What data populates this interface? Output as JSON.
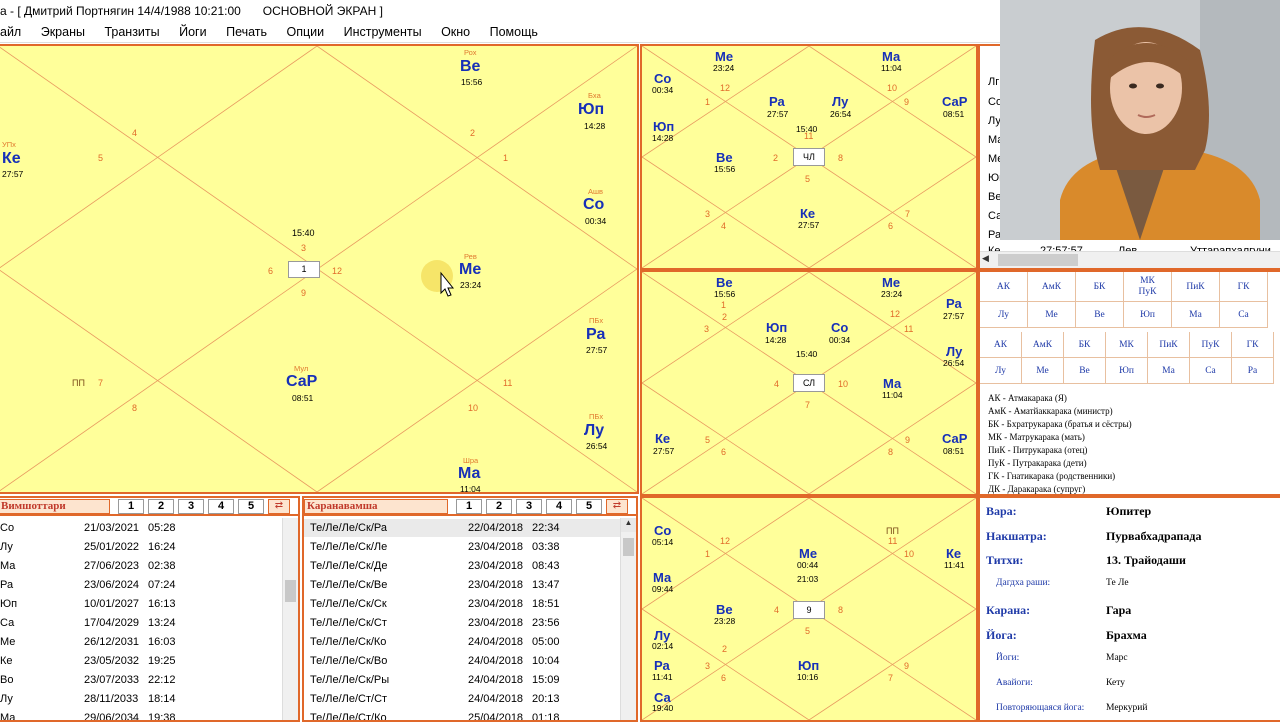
{
  "title": {
    "text": "а - [ Дмитрий Портнягин  14/4/1988  10:21:00",
    "screen": "ОСНОВНОЙ ЭКРАН ]"
  },
  "menu": [
    "айл",
    "Экраны",
    "Транзиты",
    "Йоги",
    "Печать",
    "Опции",
    "Инструменты",
    "Окно",
    "Помощь"
  ],
  "main_chart": {
    "center": {
      "time": "15:40",
      "house": "1"
    },
    "planets": [
      {
        "name": "Ве",
        "deg": "15:56",
        "nak": "Рох"
      },
      {
        "name": "Юп",
        "deg": "14:28",
        "nak": "Бхa"
      },
      {
        "name": "Ке",
        "deg": "27:57",
        "nak": "УПх"
      },
      {
        "name": "Со",
        "deg": "00:34",
        "nak": "Ашв"
      },
      {
        "name": "Ме",
        "deg": "23:24",
        "nak": "Рев"
      },
      {
        "name": "Ра",
        "deg": "27:57",
        "nak": "ПБх"
      },
      {
        "name": "СаР",
        "deg": "08:51",
        "nak": "Мул"
      },
      {
        "name": "Лу",
        "deg": "26:54",
        "nak": "ПБх"
      },
      {
        "name": "Ма",
        "deg": "11:04",
        "nak": "Шра"
      }
    ],
    "houses": [
      "4",
      "5",
      "2",
      "1",
      "3",
      "6",
      "12",
      "9",
      "7",
      "8",
      "11",
      "10"
    ],
    "extra": "ПП"
  },
  "chart_tr": {
    "center": {
      "time": "15:40",
      "label": "ЧЛ"
    },
    "planets": [
      {
        "name": "Ме",
        "deg": "23:24"
      },
      {
        "name": "Ма",
        "deg": "11:04"
      },
      {
        "name": "Со",
        "deg": "00:34"
      },
      {
        "name": "Юп",
        "deg": "14:28"
      },
      {
        "name": "Ра",
        "deg": "27:57"
      },
      {
        "name": "Лу",
        "deg": "26:54"
      },
      {
        "name": "СаР",
        "deg": "08:51"
      },
      {
        "name": "Ве",
        "deg": "15:56"
      },
      {
        "name": "Ке",
        "deg": "27:57"
      }
    ],
    "houses": [
      "1",
      "12",
      "10",
      "9",
      "11",
      "2",
      "8",
      "5",
      "3",
      "7",
      "4",
      "6"
    ]
  },
  "chart_mr": {
    "center": {
      "time": "15:40",
      "label": "СЛ"
    },
    "planets": [
      {
        "name": "Ве",
        "deg": "15:56"
      },
      {
        "name": "Ме",
        "deg": "23:24"
      },
      {
        "name": "Ра",
        "deg": "27:57"
      },
      {
        "name": "Юп",
        "deg": "14:28"
      },
      {
        "name": "Со",
        "deg": "00:34"
      },
      {
        "name": "Лу",
        "deg": "26:54"
      },
      {
        "name": "Ма",
        "deg": "11:04"
      },
      {
        "name": "Ке",
        "deg": "27:57"
      },
      {
        "name": "СаР",
        "deg": "08:51"
      }
    ],
    "houses": [
      "1",
      "2",
      "12",
      "3",
      "11",
      "4",
      "10",
      "5",
      "9",
      "6",
      "8",
      "7"
    ]
  },
  "chart_br": {
    "center": {
      "time": "21:03",
      "label": "9"
    },
    "planets": [
      {
        "name": "Со",
        "deg": "05:14"
      },
      {
        "name": "Ма",
        "deg": "09:44"
      },
      {
        "name": "Ме",
        "deg": "00:44"
      },
      {
        "name": "Ке",
        "deg": "11:41"
      },
      {
        "name": "Ве",
        "deg": "23:28"
      },
      {
        "name": "Лу",
        "deg": "02:14"
      },
      {
        "name": "Ра",
        "deg": "11:41"
      },
      {
        "name": "Юп",
        "deg": "10:16"
      },
      {
        "name": "Са",
        "deg": "19:40"
      }
    ],
    "houses": [
      "1",
      "12",
      "11",
      "2",
      "3",
      "10",
      "4",
      "9",
      "5",
      "8",
      "6",
      "7"
    ],
    "extra": "ПП"
  },
  "dasha_left": {
    "title": "Вимшоттари",
    "tabs": [
      "1",
      "2",
      "3",
      "4",
      "5"
    ],
    "rows": [
      {
        "name": "Со",
        "date": "21/03/2021",
        "time": "05:28"
      },
      {
        "name": "Лу",
        "date": "25/01/2022",
        "time": "16:24"
      },
      {
        "name": "Ма",
        "date": "27/06/2023",
        "time": "02:38"
      },
      {
        "name": "Ра",
        "date": "23/06/2024",
        "time": "07:24"
      },
      {
        "name": "Юп",
        "date": "10/01/2027",
        "time": "16:13"
      },
      {
        "name": "Са",
        "date": "17/04/2029",
        "time": "13:24"
      },
      {
        "name": "Ме",
        "date": "26/12/2031",
        "time": "16:03"
      },
      {
        "name": "Ке",
        "date": "23/05/2032",
        "time": "19:25"
      },
      {
        "name": "Во",
        "date": "23/07/2033",
        "time": "22:12"
      },
      {
        "name": "Лу",
        "date": "28/11/2033",
        "time": "18:14"
      },
      {
        "name": "Ма",
        "date": "29/06/2034",
        "time": "19:38"
      }
    ]
  },
  "dasha_right": {
    "title": "Каранавамша",
    "tabs": [
      "1",
      "2",
      "3",
      "4",
      "5"
    ],
    "rows": [
      {
        "name": "Те/Ле/Ле/Ск/Ра",
        "date": "22/04/2018",
        "time": "22:34"
      },
      {
        "name": "Те/Ле/Ле/Ск/Ле",
        "date": "23/04/2018",
        "time": "03:38"
      },
      {
        "name": "Те/Ле/Ле/Ск/Де",
        "date": "23/04/2018",
        "time": "08:43"
      },
      {
        "name": "Те/Ле/Ле/Ск/Ве",
        "date": "23/04/2018",
        "time": "13:47"
      },
      {
        "name": "Те/Ле/Ле/Ск/Ск",
        "date": "23/04/2018",
        "time": "18:51"
      },
      {
        "name": "Те/Ле/Ле/Ск/Ст",
        "date": "23/04/2018",
        "time": "23:56"
      },
      {
        "name": "Те/Ле/Ле/Ск/Ко",
        "date": "24/04/2018",
        "time": "05:00"
      },
      {
        "name": "Те/Ле/Ле/Ск/Во",
        "date": "24/04/2018",
        "time": "10:04"
      },
      {
        "name": "Те/Ле/Ле/Ск/Ры",
        "date": "24/04/2018",
        "time": "15:09"
      },
      {
        "name": "Те/Ле/Ле/Ст/Ст",
        "date": "24/04/2018",
        "time": "20:13"
      },
      {
        "name": "Те/Ле/Ле/Ст/Ко",
        "date": "25/04/2018",
        "time": "01:18"
      }
    ]
  },
  "planet_table": {
    "rows": [
      {
        "name": "Лг",
        "deg": "",
        "sign": "",
        "nak": ""
      },
      {
        "name": "Со",
        "deg": "",
        "sign": "",
        "nak": ""
      },
      {
        "name": "Лу",
        "deg": "",
        "sign": "",
        "nak": ""
      },
      {
        "name": "Ма",
        "deg": "",
        "sign": "",
        "nak": ""
      },
      {
        "name": "Ме",
        "deg": "",
        "sign": "",
        "nak": ""
      },
      {
        "name": "Юп",
        "deg": "",
        "sign": "",
        "nak": ""
      },
      {
        "name": "Ве",
        "deg": "",
        "sign": "",
        "nak": ""
      },
      {
        "name": "Са",
        "deg": "",
        "sign": "",
        "nak": ""
      },
      {
        "name": "Ра",
        "deg": "",
        "sign": "",
        "nak": ""
      },
      {
        "name": "Ке",
        "deg": "27:57:57",
        "sign": "Лев",
        "nak": "Уттарапхалгуни"
      }
    ]
  },
  "karakas1": {
    "headers": [
      "АК",
      "АмК",
      "БК",
      "МК ПуК",
      "ПиК",
      "ГК"
    ],
    "values": [
      "Лу",
      "Ме",
      "Ве",
      "Юп",
      "Ма",
      "Са"
    ]
  },
  "karakas2": {
    "headers": [
      "АК",
      "АмК",
      "БК",
      "МК",
      "ПиК",
      "ПуК",
      "ГК"
    ],
    "values": [
      "Лу",
      "Ме",
      "Ве",
      "Юп",
      "Ма",
      "Са",
      "Ра"
    ]
  },
  "legend": [
    "АК - Атмакарака (Я)",
    "АмК - Аматйаккарака (министр)",
    "БК - Бхратрукарака (братья и сёстры)",
    "МК - Матрукарака (мать)",
    "ПиК - Питрукарака (отец)",
    "ПуК - Путракарака (дети)",
    "ГК - Гнатикарака (родственники)",
    "ДК - Даракарака (супруг)"
  ],
  "panchanga": {
    "vara": {
      "label": "Вара:",
      "value": "Юпитер"
    },
    "nakshatra": {
      "label": "Накшатра:",
      "value": "Пурвабхадрапада"
    },
    "tithi": {
      "label": "Титхи:",
      "value": "13. Трайодаши"
    },
    "dagdha": {
      "label": "Дагдха раши:",
      "value": "Те  Ле"
    },
    "karana": {
      "label": "Карана:",
      "value": "Гара"
    },
    "yoga": {
      "label": "Йога:",
      "value": "Брахма"
    },
    "yogi": {
      "label": "Йоги:",
      "value": "Марс"
    },
    "avayogi": {
      "label": "Авайоги:",
      "value": "Кету"
    },
    "repeat_yoga": {
      "label": "Повторяющаяся йога:",
      "value": "Меркурий"
    }
  },
  "colors": {
    "chart_bg": "#ffff9a",
    "border": "#e0682a",
    "planet": "#1730b8",
    "house": "#e06b2a"
  }
}
